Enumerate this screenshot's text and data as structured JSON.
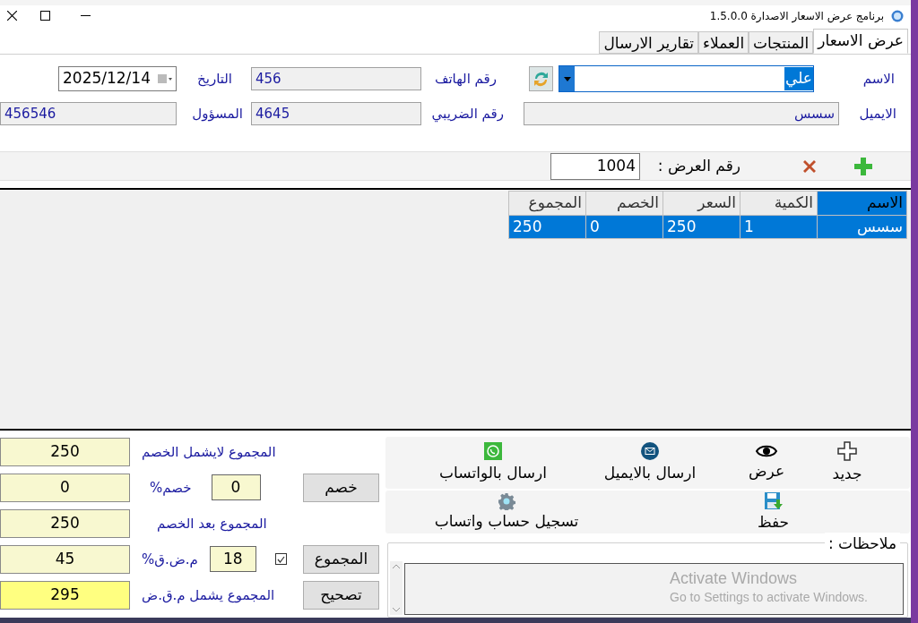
{
  "window": {
    "title": "برنامج عرض الاسعار الاصدارة 1.5.0.0"
  },
  "tabs": [
    {
      "label": "عرض الاسعار",
      "selected": true
    },
    {
      "label": "المنتجات",
      "selected": false
    },
    {
      "label": "العملاء",
      "selected": false
    },
    {
      "label": "تقارير الارسال",
      "selected": false
    }
  ],
  "customer": {
    "name_label": "الاسم",
    "name_value": "علي",
    "phone_label": "رقم الهاتف",
    "phone_value": "456",
    "date_label": "التاريخ",
    "date_value": "2025/12/14",
    "email_label": "الايميل",
    "email_value": "سسس",
    "tax_label": "رقم الضريبي",
    "tax_value": "4645",
    "manager_label": "المسؤول",
    "manager_value": "456546"
  },
  "quote": {
    "number_label": "رقم العرض :",
    "number_value": "1004"
  },
  "table": {
    "columns": [
      "الاسم",
      "الكمية",
      "السعر",
      "الخصم",
      "المجموع"
    ],
    "rows": [
      {
        "cells": [
          "سسس",
          "1",
          "250",
          "0",
          "250"
        ],
        "selected": true
      }
    ]
  },
  "totals": {
    "subtotal_label": "المجموع لايشمل الخصم",
    "subtotal_value": "250",
    "discount_button": "خصم",
    "discount_input": "0",
    "discount_label": "خصم%",
    "discount_value": "0",
    "after_label": "المجموع بعد الخصم",
    "after_value": "250",
    "total_button": "المجموع",
    "vat_checked": true,
    "vat_input": "18",
    "vat_label": "م.ض.ق%",
    "vat_value": "45",
    "fix_button": "تصحيح",
    "grand_label": "المجموع يشمل م.ق.ض",
    "grand_value": "295"
  },
  "actions": [
    {
      "label": "جديد"
    },
    {
      "label": "عرض"
    },
    {
      "label": "ارسال بالايميل"
    },
    {
      "label": "ارسال بالواتساب"
    }
  ],
  "actions_2": [
    {
      "label": "حفظ"
    },
    {
      "label": "تسجيل حساب واتساب"
    }
  ],
  "notes": {
    "label": "ملاحظات :"
  },
  "activation": {
    "title": "Activate Windows",
    "subtitle": "Go to Settings to activate Windows."
  }
}
